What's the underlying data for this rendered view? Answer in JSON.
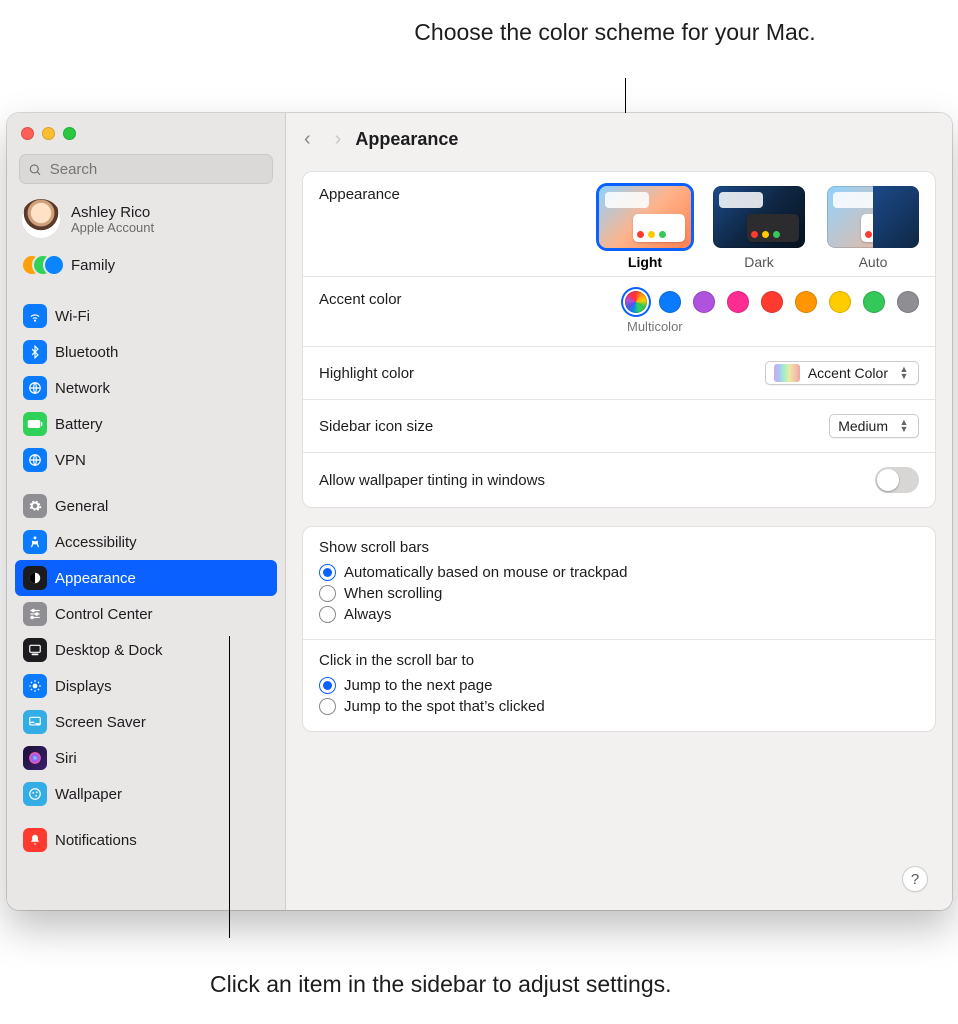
{
  "callouts": {
    "top": "Choose the color scheme for your Mac.",
    "bottom": "Click an item in the sidebar to adjust settings."
  },
  "search": {
    "placeholder": "Search"
  },
  "account": {
    "name": "Ashley Rico",
    "subtitle": "Apple Account"
  },
  "family": {
    "label": "Family"
  },
  "sidebar": {
    "groups": [
      [
        {
          "label": "Wi-Fi",
          "icon": "wifi",
          "color": "ic-blue"
        },
        {
          "label": "Bluetooth",
          "icon": "bluetooth",
          "color": "ic-blue"
        },
        {
          "label": "Network",
          "icon": "globe",
          "color": "ic-blue"
        },
        {
          "label": "Battery",
          "icon": "battery",
          "color": "ic-green"
        },
        {
          "label": "VPN",
          "icon": "globe",
          "color": "ic-blue"
        }
      ],
      [
        {
          "label": "General",
          "icon": "gear",
          "color": "ic-gray"
        },
        {
          "label": "Accessibility",
          "icon": "accessibility",
          "color": "ic-blue"
        },
        {
          "label": "Appearance",
          "icon": "appearance",
          "color": "ic-black",
          "selected": true
        },
        {
          "label": "Control Center",
          "icon": "sliders",
          "color": "ic-gray"
        },
        {
          "label": "Desktop & Dock",
          "icon": "dock",
          "color": "ic-black"
        },
        {
          "label": "Displays",
          "icon": "brightness",
          "color": "ic-blue"
        },
        {
          "label": "Screen Saver",
          "icon": "screensaver",
          "color": "ic-cyan"
        },
        {
          "label": "Siri",
          "icon": "siri",
          "color": "ic-siri"
        },
        {
          "label": "Wallpaper",
          "icon": "wallpaper",
          "color": "ic-cyan"
        }
      ],
      [
        {
          "label": "Notifications",
          "icon": "bell",
          "color": "ic-red"
        }
      ]
    ]
  },
  "header": {
    "title": "Appearance"
  },
  "appearance": {
    "label": "Appearance",
    "themes": [
      {
        "label": "Light",
        "selected": true
      },
      {
        "label": "Dark"
      },
      {
        "label": "Auto"
      }
    ]
  },
  "accent": {
    "label": "Accent color",
    "selected_name": "Multicolor",
    "colors": [
      {
        "name": "Multicolor",
        "class": "multi",
        "selected": true
      },
      {
        "name": "Blue",
        "hex": "#0a7aff"
      },
      {
        "name": "Purple",
        "hex": "#af52de"
      },
      {
        "name": "Pink",
        "hex": "#ff2d92"
      },
      {
        "name": "Red",
        "hex": "#ff3b30"
      },
      {
        "name": "Orange",
        "hex": "#ff9500"
      },
      {
        "name": "Yellow",
        "hex": "#ffcc00"
      },
      {
        "name": "Green",
        "hex": "#34c759"
      },
      {
        "name": "Graphite",
        "hex": "#8e8e93"
      }
    ]
  },
  "highlight": {
    "label": "Highlight color",
    "value": "Accent Color"
  },
  "sidebar_size": {
    "label": "Sidebar icon size",
    "value": "Medium"
  },
  "tinting": {
    "label": "Allow wallpaper tinting in windows",
    "on": false
  },
  "scroll_bars": {
    "title": "Show scroll bars",
    "options": [
      {
        "label": "Automatically based on mouse or trackpad",
        "checked": true
      },
      {
        "label": "When scrolling"
      },
      {
        "label": "Always"
      }
    ]
  },
  "scroll_click": {
    "title": "Click in the scroll bar to",
    "options": [
      {
        "label": "Jump to the next page",
        "checked": true
      },
      {
        "label": "Jump to the spot that’s clicked"
      }
    ]
  },
  "help": {
    "label": "?"
  }
}
